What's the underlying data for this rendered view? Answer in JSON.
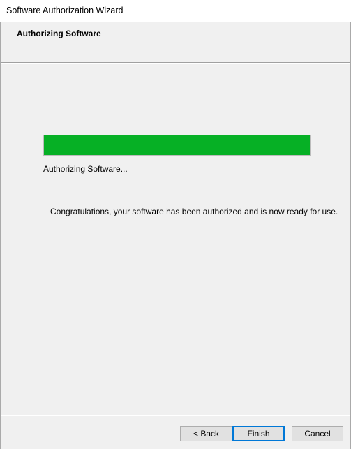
{
  "window": {
    "title": "Software Authorization Wizard"
  },
  "header": {
    "heading": "Authorizing Software"
  },
  "progress": {
    "value_percent": 100,
    "color": "#06b025"
  },
  "main": {
    "status_text": "Authorizing Software...",
    "message": "Congratulations, your software has been authorized and is now ready for use."
  },
  "footer": {
    "back_label": "< Back",
    "finish_label": "Finish",
    "cancel_label": "Cancel"
  }
}
